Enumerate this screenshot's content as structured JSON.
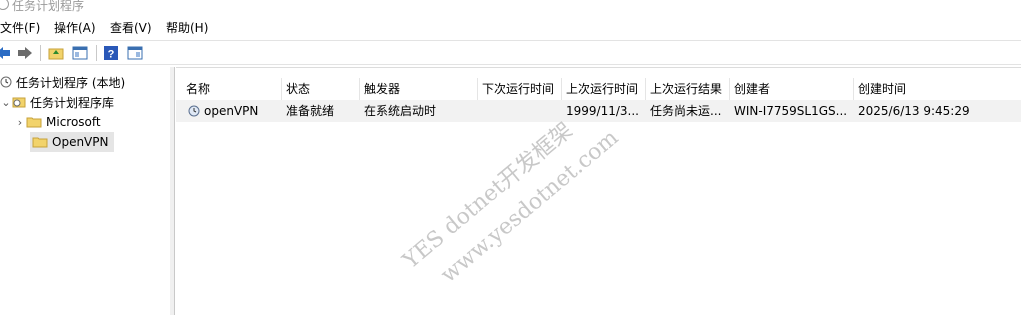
{
  "window": {
    "title": "任务计划程序"
  },
  "menu": {
    "file": "文件(F)",
    "action": "操作(A)",
    "view": "查看(V)",
    "help": "帮助(H)"
  },
  "toolbar": {
    "icons": [
      "back-arrow-icon",
      "forward-arrow-icon",
      "up-folder-icon",
      "show-hide-tree-icon",
      "help-icon",
      "show-hide-action-pane-icon"
    ]
  },
  "tree": {
    "root": "任务计划程序 (本地)",
    "library": "任务计划程序库",
    "children": [
      {
        "label": "Microsoft",
        "expanded": false
      },
      {
        "label": "OpenVPN",
        "selected": true
      }
    ]
  },
  "table": {
    "columns": [
      "名称",
      "状态",
      "触发器",
      "下次运行时间",
      "上次运行时间",
      "上次运行结果",
      "创建者",
      "创建时间"
    ],
    "rows": [
      [
        "openVPN",
        "准备就绪",
        "在系统启动时",
        "",
        "1999/11/3...",
        "任务尚未运...",
        "WIN-I7759SL1GS...",
        "2025/6/13 9:45:29"
      ]
    ]
  },
  "watermark": {
    "line1": "YES dotnet开发框架",
    "line2": "www.yesdotnet.com"
  },
  "colors": {
    "selection": "#e5e5e5",
    "row_highlight": "#f2f2f2",
    "accent": "#2b6cc4",
    "folder": "#f2d36b"
  }
}
